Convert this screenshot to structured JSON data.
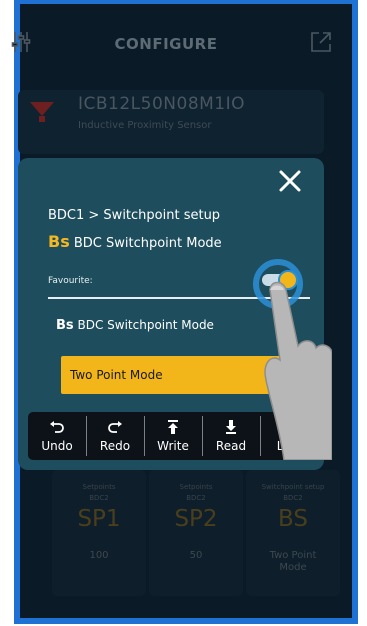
{
  "header": {
    "title": "CONFIGURE",
    "left_icon": "sliders-icon",
    "right_icon": "share-icon"
  },
  "device": {
    "model": "ICB12L50N08M1IO",
    "type": "Inductive Proximity Sensor"
  },
  "modal": {
    "breadcrumb": "BDC1 > Switchpoint setup",
    "heading_badge": "Bs",
    "heading_text": "BDC Switchpoint Mode",
    "favourite_label": "Favourite:",
    "favourite_on": true,
    "param_badge": "Bs",
    "param_text": "BDC Switchpoint Mode",
    "dropdown_value": "Two Point Mode",
    "close_icon": "close-icon"
  },
  "toolbar": {
    "buttons": [
      {
        "label": "Undo",
        "icon": "undo-icon"
      },
      {
        "label": "Redo",
        "icon": "redo-icon"
      },
      {
        "label": "Write",
        "icon": "upload-icon"
      },
      {
        "label": "Read",
        "icon": "download-icon"
      },
      {
        "label": "Live",
        "icon": "record-icon"
      }
    ]
  },
  "background_cards": [
    {
      "line1": "Setpoints",
      "line2": "BDC2",
      "big": "SP1",
      "value": "100"
    },
    {
      "line1": "Setpoints",
      "line2": "BDC2",
      "big": "SP2",
      "value": "50"
    },
    {
      "line1": "Switchpoint setup",
      "line2": "BDC2",
      "big": "BS",
      "value_line1": "Two Point",
      "value_line2": "Mode"
    }
  ],
  "colors": {
    "frame": "#1f72d3",
    "screen": "#0a1a26",
    "modal": "#1e4e5d",
    "accent": "#f2b61b",
    "toggle_ring": "#2b8fd6"
  }
}
